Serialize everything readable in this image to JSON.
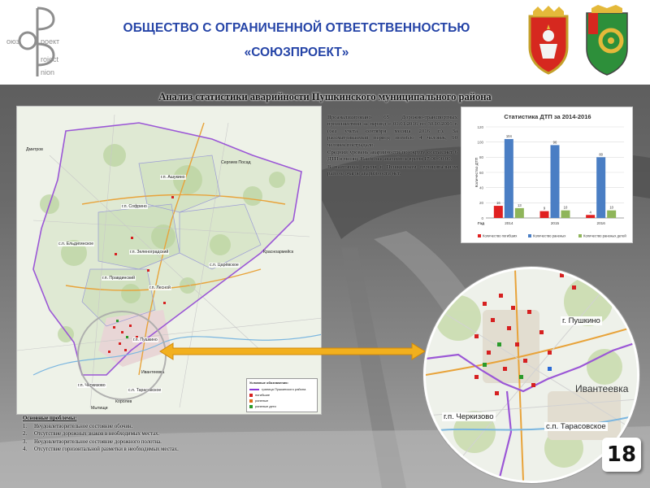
{
  "header": {
    "company_line1": "ОБЩЕСТВО С ОГРАНИЧЕННОЙ ОТВЕТСТВЕННОСТЬЮ",
    "company_line2": "«СОЮЗПРОЕКТ»",
    "logo_text": {
      "word1": "оюз",
      "word2": "роект",
      "word3": "roject",
      "word4": "nion"
    }
  },
  "slide_title": "Анализ статистики аварийности Пушкинского муниципального района",
  "analysis": {
    "paragraph1": "Проанализировано 65 Дорожно-транспортных происшествий за период с 01.01.2016 по 30.10.2016 г. (без учета сентября месяца 2016 г.). За рассматриваемый период погибло 4 человек, 90 человек пострадало.",
    "paragraph2": "Средний уровень аварийности по округу составляет 6 ДТП в месяц. Наиболее аварийное время 17:00-00:00.",
    "paragraph3": "В настоящее время в Пушкинском муниципальном районе очагов аварийности нет."
  },
  "map": {
    "labels": {
      "dmitrov": "Дмитров",
      "sergiev_posad": "Сергиев Посад",
      "ashukino": "г.п. Ашукино",
      "sofrino": "г.п. Софрино",
      "eldigino": "с.п. Ельдигинское",
      "zelenogradsky": "г.п. Зеленоградский",
      "tsarevskoe": "с.п. Царёвское",
      "krasnoarmeysk": "Красноармейск",
      "pravdinsky": "г.п. Правдинский",
      "lesnoy": "г.п. Лесной",
      "pushkino": "г.п. Пушкино",
      "ivanteevka": "Ивантеевка",
      "cherkizovo": "г.п. Черкизово",
      "tarasovskoe": "с.п. Тарасовское",
      "mytishchi": "Мытищи",
      "korolev": "Королев"
    },
    "legend": {
      "title": "Условные обозначения:",
      "border": "граница Пушкинского района",
      "killed": "погибшие",
      "injured": "раненые",
      "injured_children": "раненые дети"
    }
  },
  "zoom": {
    "labels": {
      "pushkino": "г. Пушкино",
      "ivanteevka": "Ивантеевка",
      "cherkizovo": "г.п. Черкизово",
      "tarasovskoe": "с.п. Тарасовское"
    }
  },
  "chart_data": {
    "type": "bar",
    "title": "Статистика ДТП за 2014-2016",
    "ylabel": "Количество ДТП",
    "xlabel": "Год",
    "categories": [
      "2014",
      "2015",
      "2016"
    ],
    "ylim": [
      0,
      120
    ],
    "yticks": [
      0,
      20,
      40,
      60,
      80,
      100,
      120
    ],
    "series": [
      {
        "name": "Количество погибших",
        "color": "#e02020",
        "values": [
          16,
          9,
          4
        ]
      },
      {
        "name": "Количество раненых",
        "color": "#4a7ec4",
        "values": [
          104,
          96,
          80
        ]
      },
      {
        "name": "Количество раненых детей",
        "color": "#8fb55a",
        "values": [
          13,
          10,
          10
        ]
      }
    ],
    "grid": true,
    "legend": "bottom"
  },
  "problems": {
    "title": "Основные проблемы:",
    "items": [
      {
        "num": "1.",
        "text": "Неудовлетворительное состояние обочин."
      },
      {
        "num": "2.",
        "text": "Отсутствие дорожных знаков в необходимых местах."
      },
      {
        "num": "3.",
        "text": "Неудовлетворительное состояние дорожного полотна."
      },
      {
        "num": "4.",
        "text": "Отсутствие горизонтальной разметки в необходимых местах."
      }
    ]
  },
  "page_number": "18"
}
